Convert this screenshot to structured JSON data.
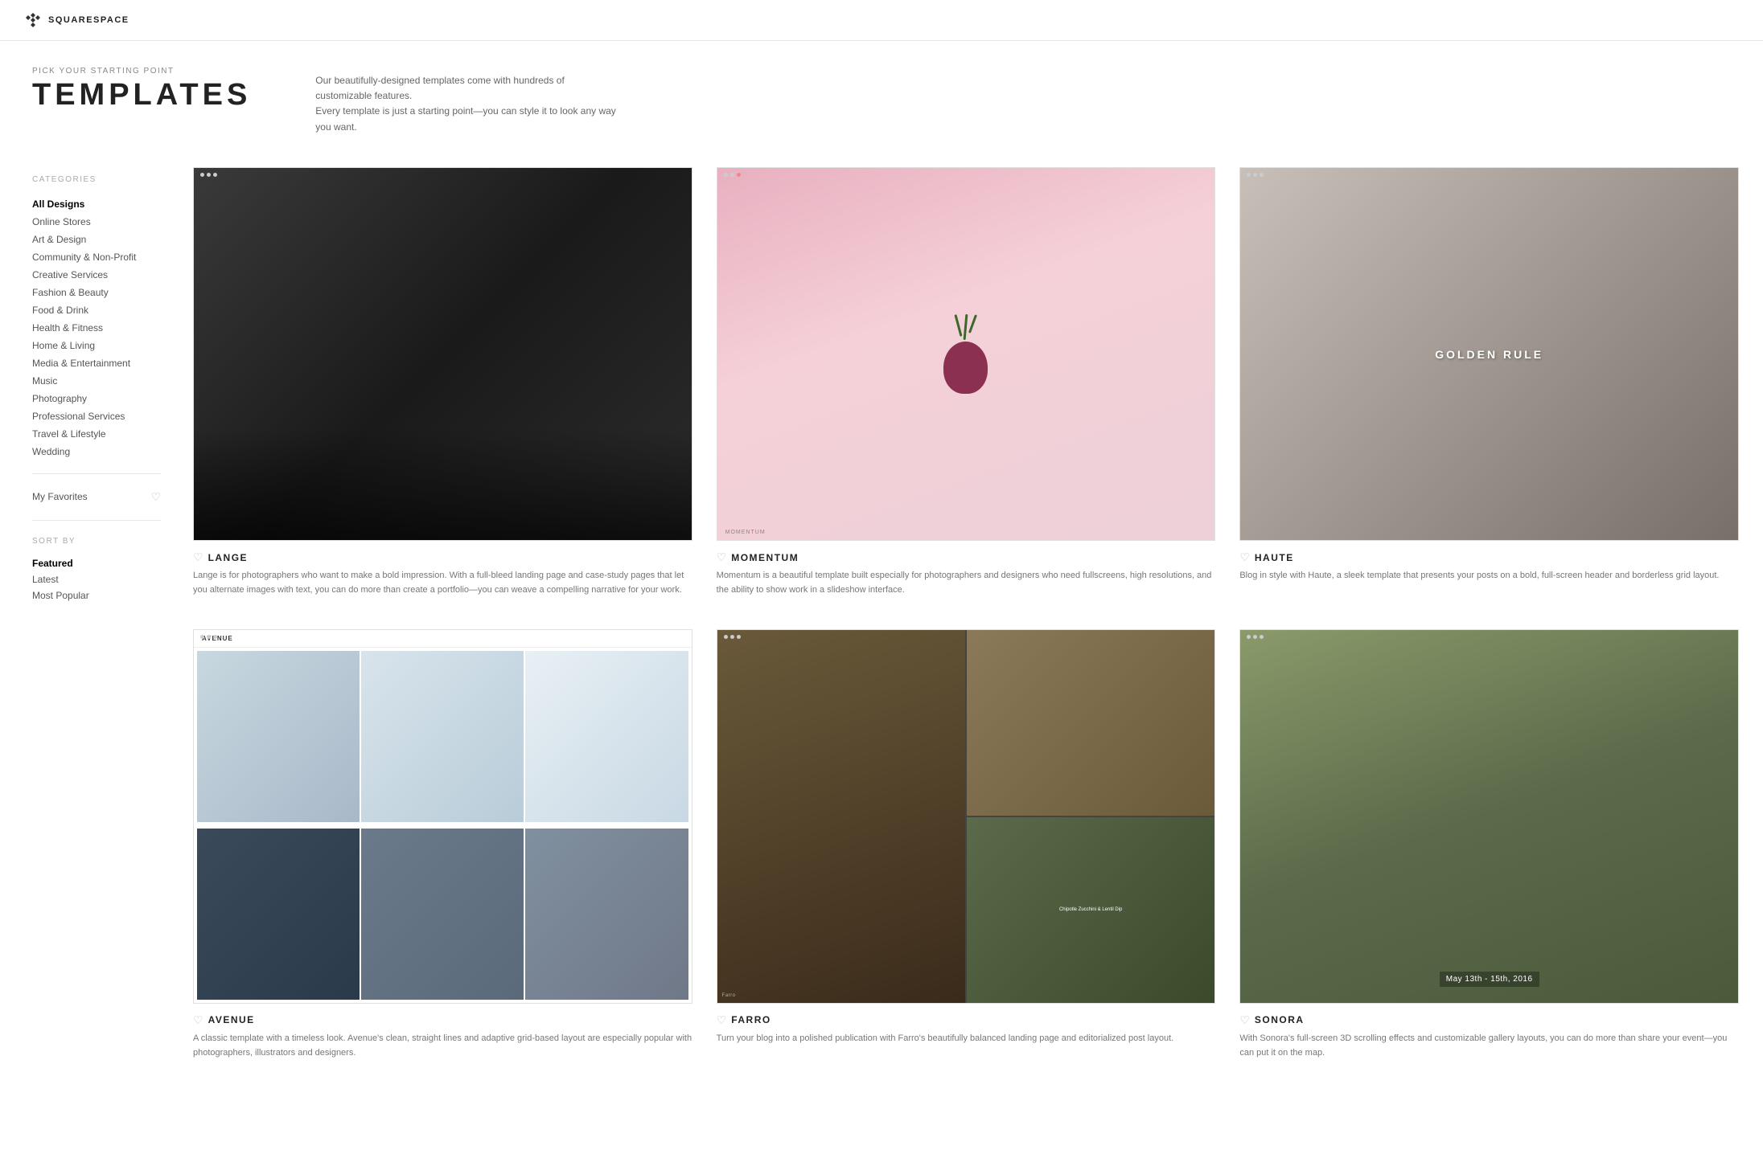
{
  "topbar": {
    "logo_text": "SQUARESPACE"
  },
  "page_header": {
    "subtitle": "PICK YOUR STARTING POINT",
    "title": "TEMPLATES",
    "description_line1": "Our beautifully-designed templates come with hundreds of customizable features.",
    "description_line2": "Every template is just a starting point—you can style it to look any way you want."
  },
  "sidebar": {
    "categories_label": "CATEGORIES",
    "items": [
      {
        "label": "All Designs",
        "active": true
      },
      {
        "label": "Online Stores",
        "active": false
      },
      {
        "label": "Art & Design",
        "active": false
      },
      {
        "label": "Community & Non-Profit",
        "active": false
      },
      {
        "label": "Creative Services",
        "active": false
      },
      {
        "label": "Fashion & Beauty",
        "active": false
      },
      {
        "label": "Food & Drink",
        "active": false
      },
      {
        "label": "Health & Fitness",
        "active": false
      },
      {
        "label": "Home & Living",
        "active": false
      },
      {
        "label": "Media & Entertainment",
        "active": false
      },
      {
        "label": "Music",
        "active": false
      },
      {
        "label": "Photography",
        "active": false
      },
      {
        "label": "Professional Services",
        "active": false
      },
      {
        "label": "Travel & Lifestyle",
        "active": false
      },
      {
        "label": "Wedding",
        "active": false
      }
    ],
    "my_favorites": "My Favorites",
    "sort_label": "SORT BY",
    "sort_items": [
      {
        "label": "Featured",
        "active": true
      },
      {
        "label": "Latest",
        "active": false
      },
      {
        "label": "Most Popular",
        "active": false
      }
    ]
  },
  "templates": [
    {
      "id": "lange",
      "name": "LANGE",
      "description": "Lange is for photographers who want to make a bold impression. With a full-bleed landing page and case-study pages that let you alternate images with text, you can do more than create a portfolio—you can weave a compelling narrative for your work."
    },
    {
      "id": "momentum",
      "name": "MOMENTUM",
      "description": "Momentum is a beautiful template built especially for photographers and designers who need fullscreens, high resolutions, and the ability to show work in a slideshow interface."
    },
    {
      "id": "haute",
      "name": "HAUTE",
      "description": "Blog in style with Haute, a sleek template that presents your posts on a bold, full-screen header and borderless grid layout.",
      "overlay_text": "GOLDEN RULE"
    },
    {
      "id": "avenue",
      "name": "AVENUE",
      "description": "A classic template with a timeless look. Avenue's clean, straight lines and adaptive grid-based layout are especially popular with photographers, illustrators and designers."
    },
    {
      "id": "farro",
      "name": "FARRO",
      "description": "Turn your blog into a polished publication with Farro's beautifully balanced landing page and editorialized post layout.",
      "cell_text": "Chipotle Zucchini & Lentil Dip"
    },
    {
      "id": "sonora",
      "name": "SONORA",
      "description": "With Sonora's full-screen 3D scrolling effects and customizable gallery layouts, you can do more than share your event—you can put it on the map.",
      "date_text": "May 13th - 15th, 2016"
    }
  ]
}
